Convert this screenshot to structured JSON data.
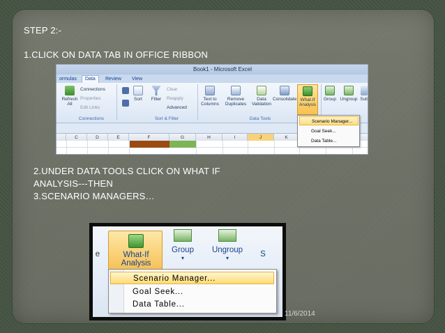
{
  "slide": {
    "step_title": "STEP 2:-",
    "step1": "1.CLICK ON DATA TAB IN OFFICE RIBBON",
    "step2_line1": "2.UNDER  DATA TOOLS  CLICK ON WHAT IF",
    "step2_line2": "ANALYSIS---THEN",
    "step3": "3.SCENARIO MANAGERS…",
    "date": "11/6/2014"
  },
  "excel": {
    "window_title": "Book1 - Microsoft Excel",
    "tabs": [
      "ormulas",
      "Data",
      "Review",
      "View"
    ],
    "active_tab": "Data",
    "connections_group": {
      "refresh": "Refresh All",
      "connections": "Connections",
      "properties": "Properties",
      "edit_links": "Edit Links",
      "label": "Connections"
    },
    "sort_filter_group": {
      "sort": "Sort",
      "filter": "Filter",
      "clear": "Clear",
      "reapply": "Reapply",
      "advanced": "Advanced",
      "label": "Sort & Filter"
    },
    "data_tools_group": {
      "text_to_columns": "Text to Columns",
      "remove_duplicates": "Remove Duplicates",
      "data_validation": "Data Validation",
      "consolidate": "Consolidate",
      "what_if": "What-If Analysis",
      "label": "Data Tools"
    },
    "outline_group": {
      "group": "Group",
      "ungroup": "Ungroup",
      "subtotal": "Sub"
    },
    "whatif_menu": [
      "Scenario Manager...",
      "Goal Seek...",
      "Data Table..."
    ],
    "columns": [
      "C",
      "D",
      "E",
      "F",
      "G",
      "H",
      "I",
      "J",
      "K"
    ],
    "cell_colors": {
      "F": "#9b4a12",
      "G": "#7eb356"
    }
  },
  "zoom": {
    "what_if_line1": "What-If",
    "what_if_line2": "Analysis",
    "group": "Group",
    "ungroup": "Ungroup",
    "edge_left": "e",
    "edge_right": "S",
    "menu": [
      "Scenario Manager...",
      "Goal Seek...",
      "Data Table..."
    ]
  }
}
